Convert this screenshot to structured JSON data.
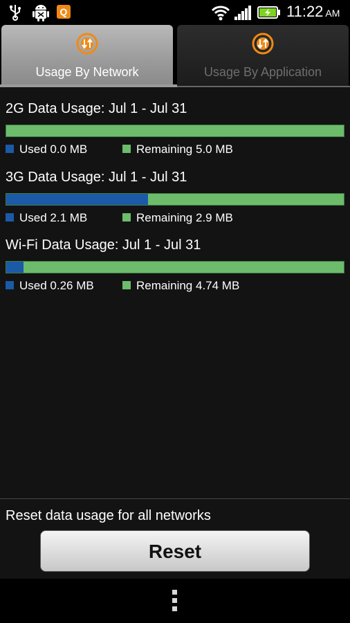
{
  "status_bar": {
    "time": "11:22",
    "ampm": "AM",
    "app_icon_letter": "Q",
    "icons": [
      "usb-icon",
      "android-debug-icon",
      "q-app-icon",
      "wifi-icon",
      "signal-icon",
      "battery-charging-icon"
    ]
  },
  "tabs": [
    {
      "label": "Usage By Network",
      "active": true,
      "icon": "data-transfer-icon"
    },
    {
      "label": "Usage By Application",
      "active": false,
      "icon": "data-transfer-icon"
    }
  ],
  "networks": [
    {
      "title": "2G Data Usage: Jul 1 - Jul 31",
      "used_label": "Used 0.0 MB",
      "remaining_label": "Remaining 5.0 MB",
      "used_fraction": 0.0
    },
    {
      "title": "3G Data Usage: Jul 1 - Jul 31",
      "used_label": "Used 2.1 MB",
      "remaining_label": "Remaining 2.9 MB",
      "used_fraction": 0.42
    },
    {
      "title": "Wi-Fi Data Usage: Jul 1 - Jul 31",
      "used_label": "Used 0.26 MB",
      "remaining_label": "Remaining 4.74 MB",
      "used_fraction": 0.052
    }
  ],
  "reset": {
    "caption": "Reset data usage for all networks",
    "button_label": "Reset"
  },
  "colors": {
    "used": "#1b5aa6",
    "remaining": "#6cbc6c",
    "tab_icon": "#f08a16"
  }
}
